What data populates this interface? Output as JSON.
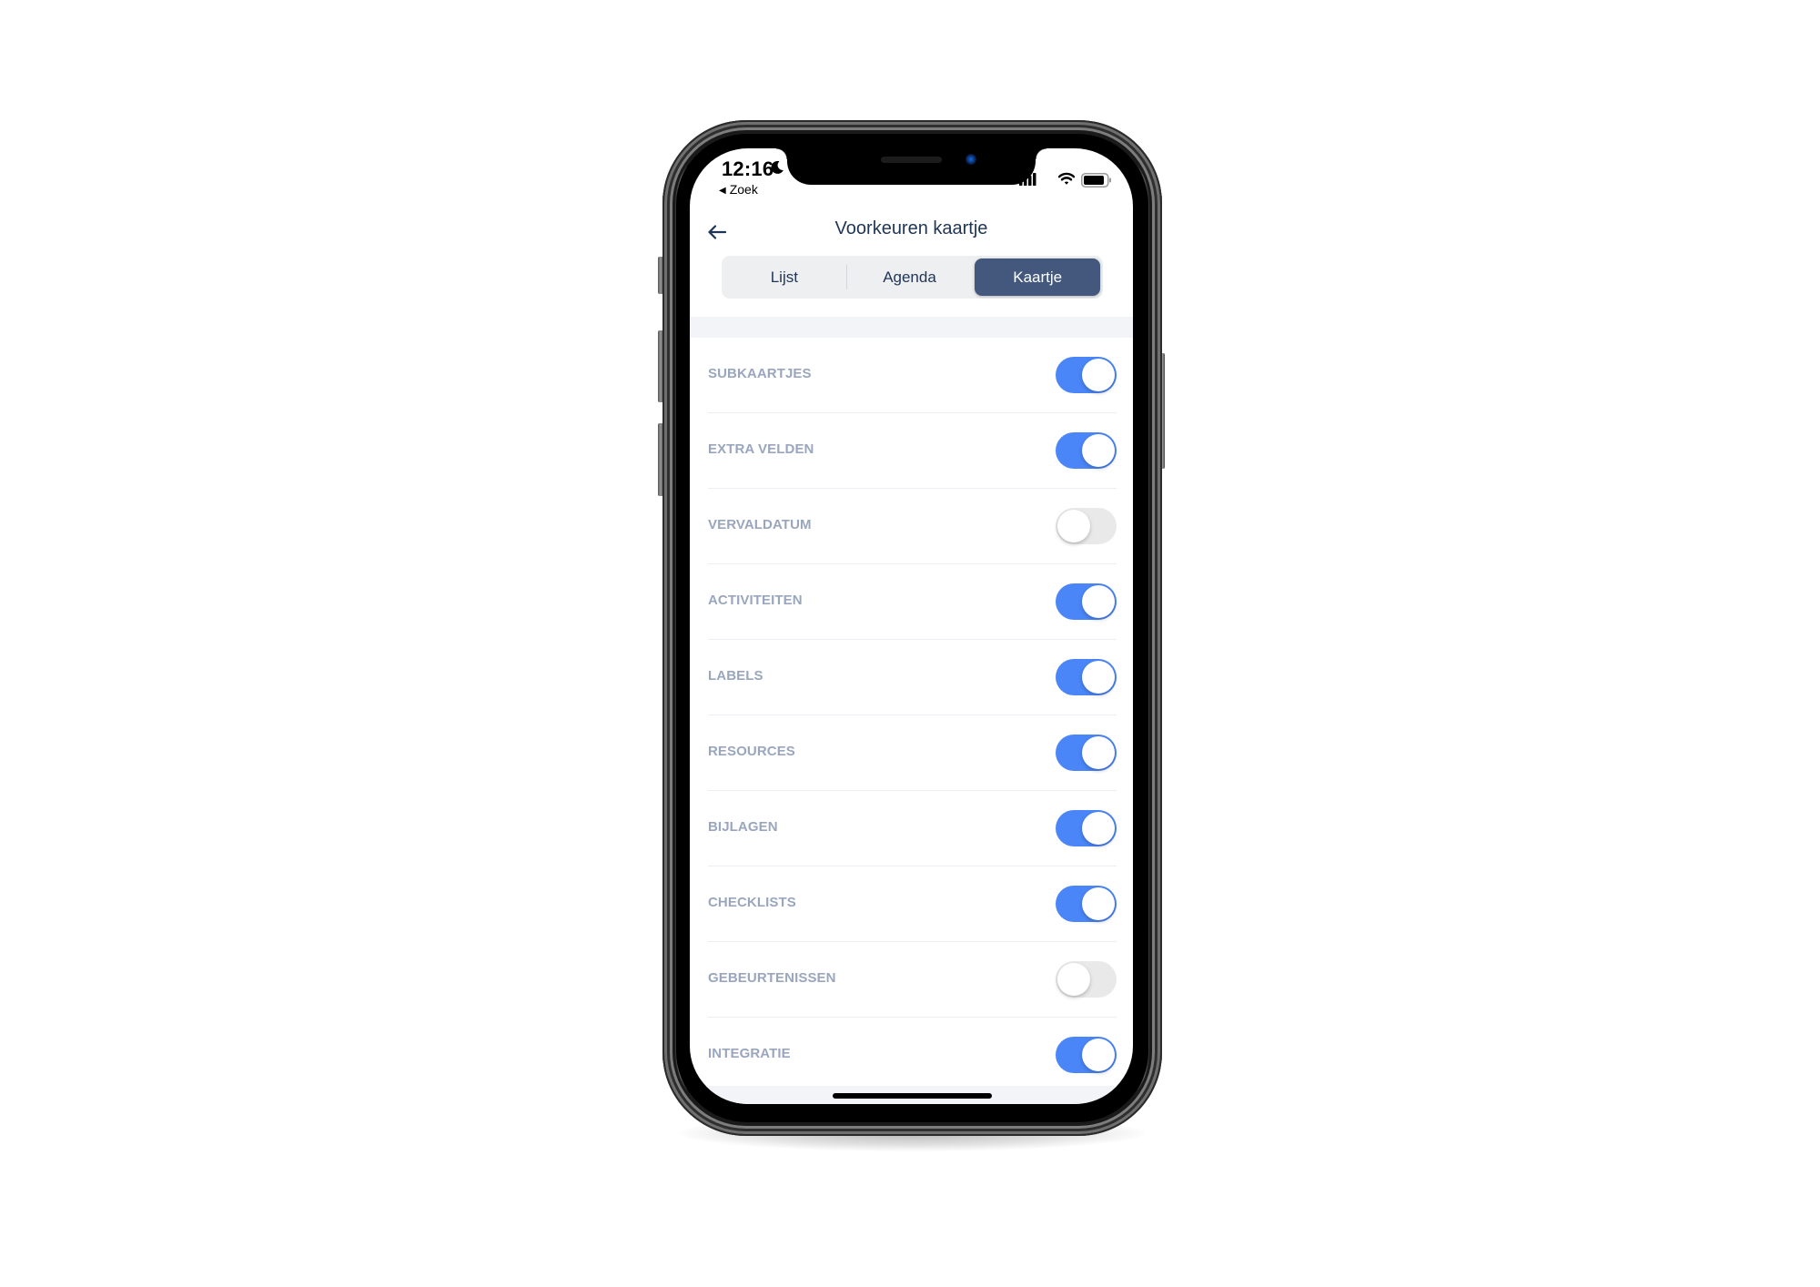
{
  "status_bar": {
    "time": "12:16",
    "back_app": "Zoek",
    "icons": [
      "moon-icon",
      "signal-icon",
      "wifi-icon",
      "battery-icon"
    ]
  },
  "nav": {
    "back_icon": "arrow-left-icon",
    "title": "Voorkeuren kaartje"
  },
  "tabs": [
    {
      "label": "Lijst",
      "selected": false
    },
    {
      "label": "Agenda",
      "selected": false
    },
    {
      "label": "Kaartje",
      "selected": true
    }
  ],
  "settings": [
    {
      "label": "SUBKAARTJES",
      "enabled": true
    },
    {
      "label": "EXTRA VELDEN",
      "enabled": true
    },
    {
      "label": "VERVALDATUM",
      "enabled": false
    },
    {
      "label": "ACTIVITEITEN",
      "enabled": true
    },
    {
      "label": "LABELS",
      "enabled": true
    },
    {
      "label": "RESOURCES",
      "enabled": true
    },
    {
      "label": "BIJLAGEN",
      "enabled": true
    },
    {
      "label": "CHECKLISTS",
      "enabled": true
    },
    {
      "label": "GEBEURTENISSEN",
      "enabled": false
    },
    {
      "label": "INTEGRATIE",
      "enabled": true
    }
  ],
  "colors": {
    "accent": "#4a86f7",
    "selected_tab": "#44587e",
    "title_text": "#1f3556",
    "label_text": "#9aa6bd",
    "toggle_off": "#e9e9ea"
  }
}
